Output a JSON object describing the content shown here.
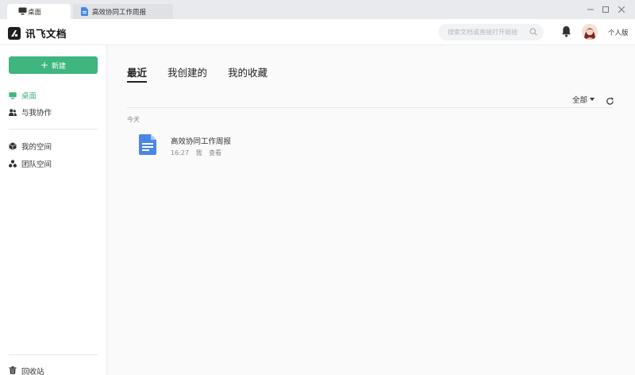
{
  "window": {
    "tabs": [
      {
        "label": "桌面",
        "icon": "monitor-icon",
        "active": true
      },
      {
        "label": "高效协同工作周报",
        "icon": "doc-icon",
        "active": false
      }
    ]
  },
  "header": {
    "brand": "讯飞文档",
    "search_placeholder": "搜索文档或直接打开链接",
    "personal_label": "个人版"
  },
  "sidebar": {
    "new_button": "新建",
    "items": [
      {
        "label": "桌面",
        "icon": "monitor-icon",
        "active": true
      },
      {
        "label": "与我协作",
        "icon": "people-icon"
      },
      {
        "label": "我的空间",
        "icon": "cube-icon"
      },
      {
        "label": "团队空间",
        "icon": "team-icon"
      }
    ],
    "trash": "回收站"
  },
  "main": {
    "tabs": [
      {
        "label": "最近",
        "active": true
      },
      {
        "label": "我创建的"
      },
      {
        "label": "我的收藏"
      }
    ],
    "filter_label": "全部",
    "group_label": "今天",
    "documents": [
      {
        "title": "高效协同工作周报",
        "time": "16:27",
        "owner": "我",
        "action": "查看"
      }
    ]
  },
  "colors": {
    "accent": "#3fb57f",
    "doc_blue": "#4a86e8"
  }
}
